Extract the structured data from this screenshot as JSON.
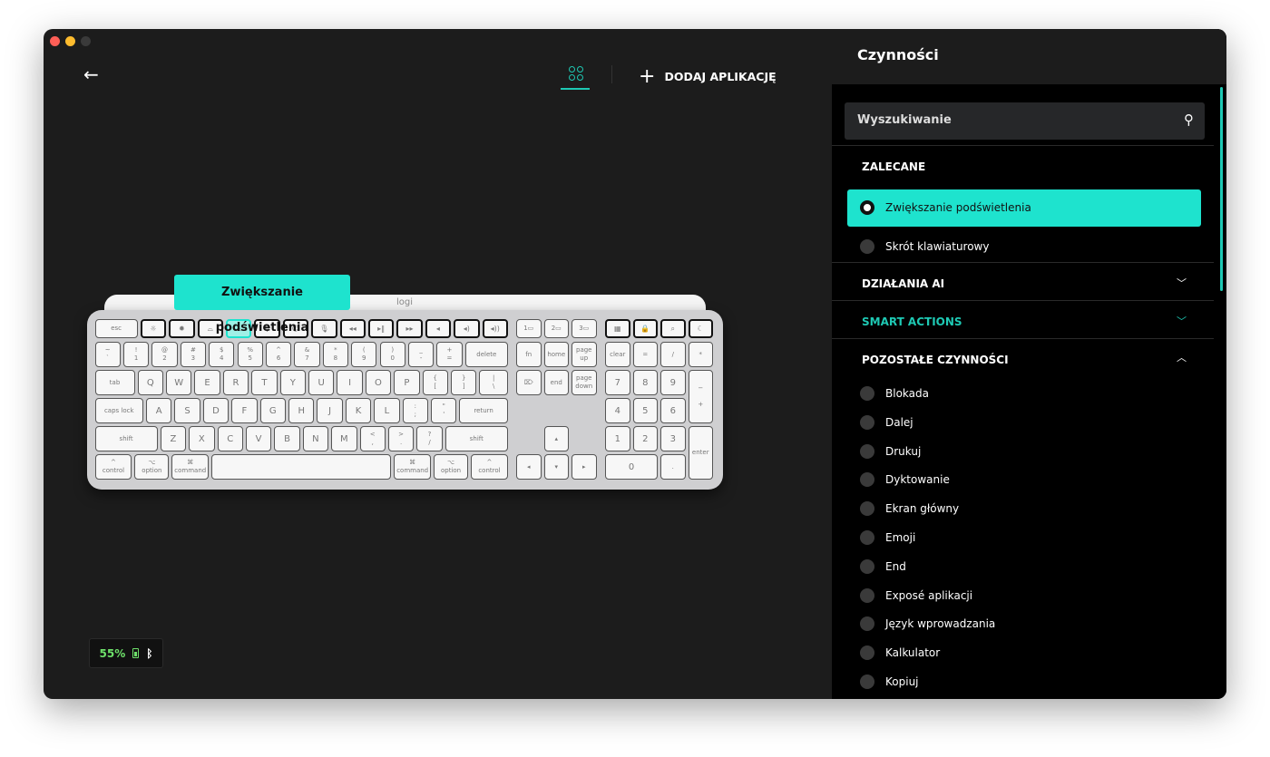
{
  "window": {
    "controls": [
      "close",
      "minimize",
      "maximize"
    ],
    "colors": {
      "close": "#ff5f57",
      "minimize": "#febc2e",
      "maximize": "#3a3a3a"
    }
  },
  "header": {
    "back_icon": "arrow-left-icon",
    "apps_icon": "grid-icon",
    "add_app_label": "DODAJ APLIKACJĘ"
  },
  "tooltip": "Zwiększanie podświetlenia",
  "keyboard": {
    "logo": "logi",
    "main_rows": [
      [
        "esc",
        "☼",
        "✹",
        "⌓",
        "⌓",
        "⚲",
        "☺",
        "🎙",
        "◂◂",
        "▸‖",
        "▸▸",
        "◂",
        "◂)",
        "◂))"
      ],
      [
        "~\n`",
        "!\n1",
        "@\n2",
        "#\n3",
        "$\n4",
        "%\n5",
        "^\n6",
        "&\n7",
        "*\n8",
        "(\n9",
        ")\n0",
        "_\n-",
        "+\n=",
        "delete"
      ],
      [
        "tab",
        "Q",
        "W",
        "E",
        "R",
        "T",
        "Y",
        "U",
        "I",
        "O",
        "P",
        "{\n[",
        "}\n]",
        "|\n\\"
      ],
      [
        "caps lock",
        "A",
        "S",
        "D",
        "F",
        "G",
        "H",
        "J",
        "K",
        "L",
        ":\n;",
        "\"\n'",
        "return"
      ],
      [
        "shift",
        "Z",
        "X",
        "C",
        "V",
        "B",
        "N",
        "M",
        "<\n,",
        ">\n.",
        "?\n/",
        "shift"
      ],
      [
        "^\ncontrol",
        "⌥\noption",
        "⌘\ncommand",
        "",
        "⌘\ncommand",
        "⌥\noption",
        "^\ncontrol"
      ]
    ],
    "nav": [
      [
        "1▭",
        "2▭",
        "3▭"
      ],
      [
        "fn",
        "home",
        "page\nup"
      ],
      [
        "⌦",
        "end",
        "page\ndown"
      ],
      [
        "▴"
      ],
      [
        "◂",
        "▾",
        "▸"
      ]
    ],
    "numpad": [
      [
        "▦",
        "🔒",
        "⌕",
        "☾"
      ],
      [
        "clear",
        "=",
        "/",
        "*"
      ],
      [
        "7",
        "8",
        "9",
        "−\n\n+"
      ],
      [
        "4",
        "5",
        "6"
      ],
      [
        "1",
        "2",
        "3",
        "enter"
      ],
      [
        "0",
        "."
      ]
    ],
    "highlighted_key": "backlight-up",
    "accent": "#1ee3ce"
  },
  "battery": {
    "level": "55%",
    "level_value": 55,
    "connection": "bluetooth"
  },
  "panel": {
    "title": "Czynności",
    "search_placeholder": "Wyszukiwanie",
    "recommended": {
      "label": "ZALECANE",
      "items": [
        {
          "label": "Zwiększanie podświetlenia",
          "selected": true
        },
        {
          "label": "Skrót klawiaturowy",
          "selected": false
        }
      ]
    },
    "sections": [
      {
        "label": "DZIAŁANIA AI",
        "expanded": false
      },
      {
        "label": "SMART ACTIONS",
        "expanded": false,
        "color": "#1ec9b4"
      },
      {
        "label": "POZOSTAŁE CZYNNOŚCI",
        "expanded": true
      }
    ],
    "other_actions": [
      "Blokada",
      "Dalej",
      "Drukuj",
      "Dyktowanie",
      "Ekran główny",
      "Emoji",
      "End",
      "Exposé aplikacji",
      "Język wprowadzania",
      "Kalkulator",
      "Kopiuj"
    ]
  }
}
